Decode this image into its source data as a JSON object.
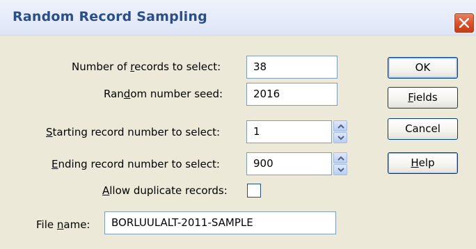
{
  "window": {
    "title": "Random Record Sampling"
  },
  "fields": {
    "num_records": {
      "pre": "Number of ",
      "key": "r",
      "post": "ecords to select:",
      "value": "38"
    },
    "seed": {
      "pre": "Ran",
      "key": "d",
      "post": "om number seed:",
      "value": "2016"
    },
    "start": {
      "pre": "",
      "key": "S",
      "post": "tarting record number to select:",
      "value": "1"
    },
    "end": {
      "pre": "",
      "key": "E",
      "post": "nding record number to select:",
      "value": "900"
    },
    "duplicates": {
      "pre": "",
      "key": "A",
      "post": "llow duplicate records:",
      "checked": false
    },
    "filename": {
      "pre": "File ",
      "key": "n",
      "post": "ame:",
      "value": "BORLUULALT-2011-SAMPLE"
    }
  },
  "buttons": {
    "ok": "OK",
    "fields": {
      "key": "F",
      "post": "ields"
    },
    "cancel": "Cancel",
    "help": {
      "key": "H",
      "post": "elp"
    }
  },
  "icons": {
    "close": "close-icon",
    "spin_up": "spin-up-icon",
    "spin_down": "spin-down-icon"
  },
  "colors": {
    "dialog_bg": "#ece9d8",
    "title_text": "#2a4f88",
    "close_button": "#d94e27",
    "field_border": "#7f9db9"
  }
}
